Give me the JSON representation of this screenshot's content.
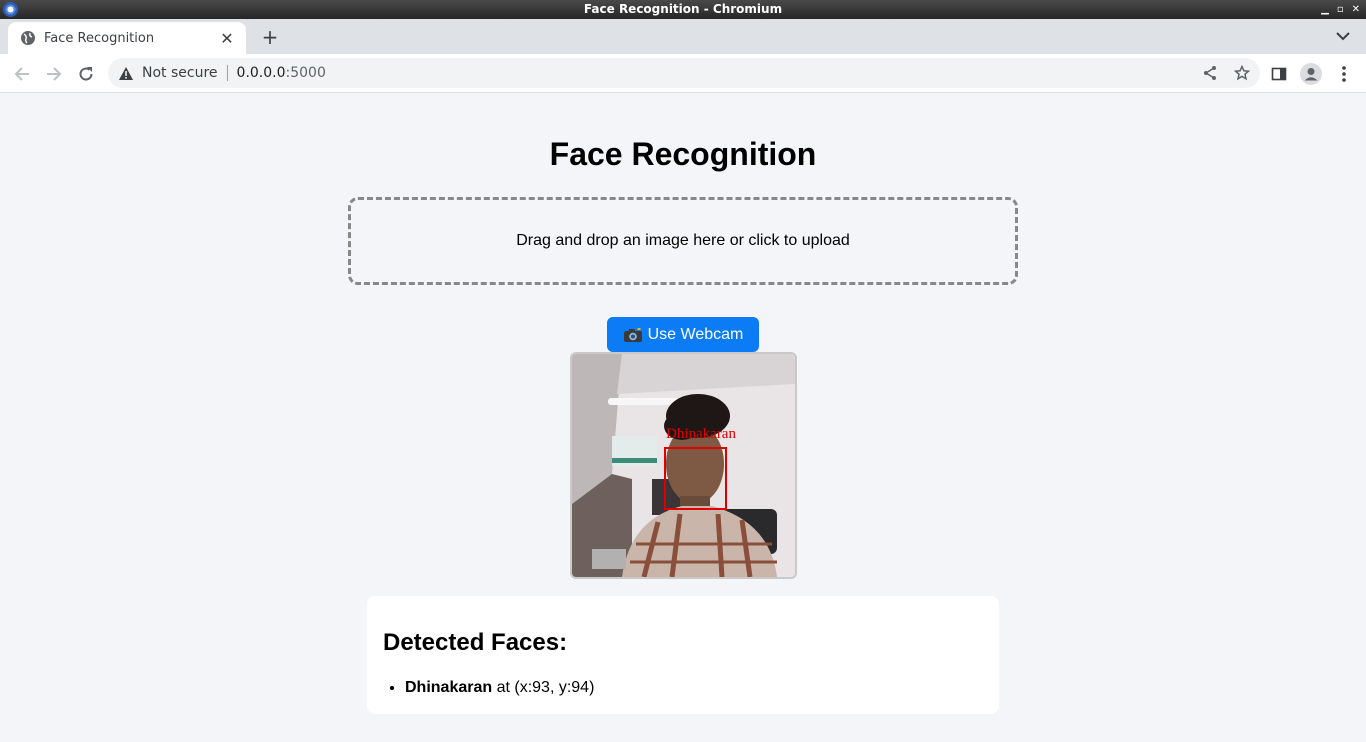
{
  "window": {
    "title": "Face Recognition - Chromium"
  },
  "browser": {
    "tab_title": "Face Recognition",
    "security_label": "Not secure",
    "url_host": "0.0.0.0",
    "url_port": ":5000"
  },
  "page": {
    "title": "Face Recognition",
    "dropzone_text": "Drag and drop an image here or click to upload",
    "webcam_button_label": "Use Webcam",
    "preview_overlay_label": "Dhinakaran",
    "results_heading": "Detected Faces:",
    "faces": [
      {
        "name": "Dhinakaran",
        "location": " at (x:93, y:94)"
      }
    ]
  },
  "colors": {
    "accent": "#0b7cf5",
    "face_box": "#e00000",
    "page_bg": "#f4f5f9"
  }
}
